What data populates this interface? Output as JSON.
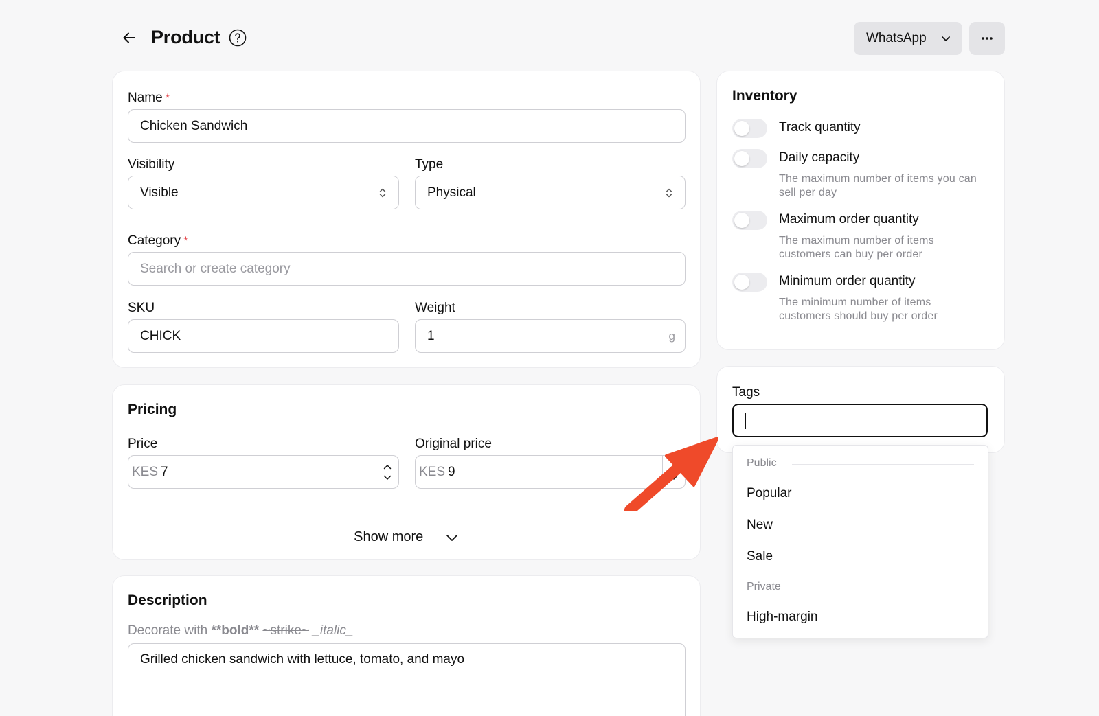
{
  "header": {
    "title": "Product",
    "channel": "WhatsApp",
    "icons": {
      "back": "arrow-left-icon",
      "help": "question-circle-icon",
      "more": "ellipsis-icon"
    }
  },
  "details": {
    "name_label": "Name",
    "name_value": "Chicken Sandwich",
    "visibility_label": "Visibility",
    "visibility_value": "Visible",
    "type_label": "Type",
    "type_value": "Physical",
    "category_label": "Category",
    "category_placeholder": "Search or create category",
    "sku_label": "SKU",
    "sku_value": "CHICK",
    "weight_label": "Weight",
    "weight_value": "1",
    "weight_unit": "g",
    "required_mark": "*"
  },
  "pricing": {
    "title": "Pricing",
    "price_label": "Price",
    "price_currency": "KES",
    "price_value": "7",
    "original_label": "Original price",
    "original_currency": "KES",
    "original_value": "9",
    "show_more": "Show more"
  },
  "description": {
    "title": "Description",
    "hint_prefix": "Decorate with ",
    "hint_bold": "**bold**",
    "hint_strike": "~strike~",
    "hint_italic": "_italic_",
    "value": "Grilled chicken sandwich with lettuce, tomato, and mayo"
  },
  "inventory": {
    "title": "Inventory",
    "options": [
      {
        "title": "Track quantity",
        "desc": "",
        "enabled": false
      },
      {
        "title": "Daily capacity",
        "desc": "The maximum number of items you can sell per day",
        "enabled": false
      },
      {
        "title": "Maximum order quantity",
        "desc": "The maximum number of items customers can buy per order",
        "enabled": false
      },
      {
        "title": "Minimum order quantity",
        "desc": "The minimum number of items customers should buy per order",
        "enabled": false
      }
    ]
  },
  "tags": {
    "label": "Tags",
    "input_value": "",
    "groups": [
      {
        "label": "Public",
        "items": [
          "Popular",
          "New",
          "Sale"
        ]
      },
      {
        "label": "Private",
        "items": [
          "High-margin"
        ]
      }
    ]
  },
  "colors": {
    "background": "#f7f7f8",
    "card": "#ffffff",
    "required": "#e5484d",
    "annotation_arrow": "#ef4a2a",
    "muted_text": "#8a8a90"
  }
}
